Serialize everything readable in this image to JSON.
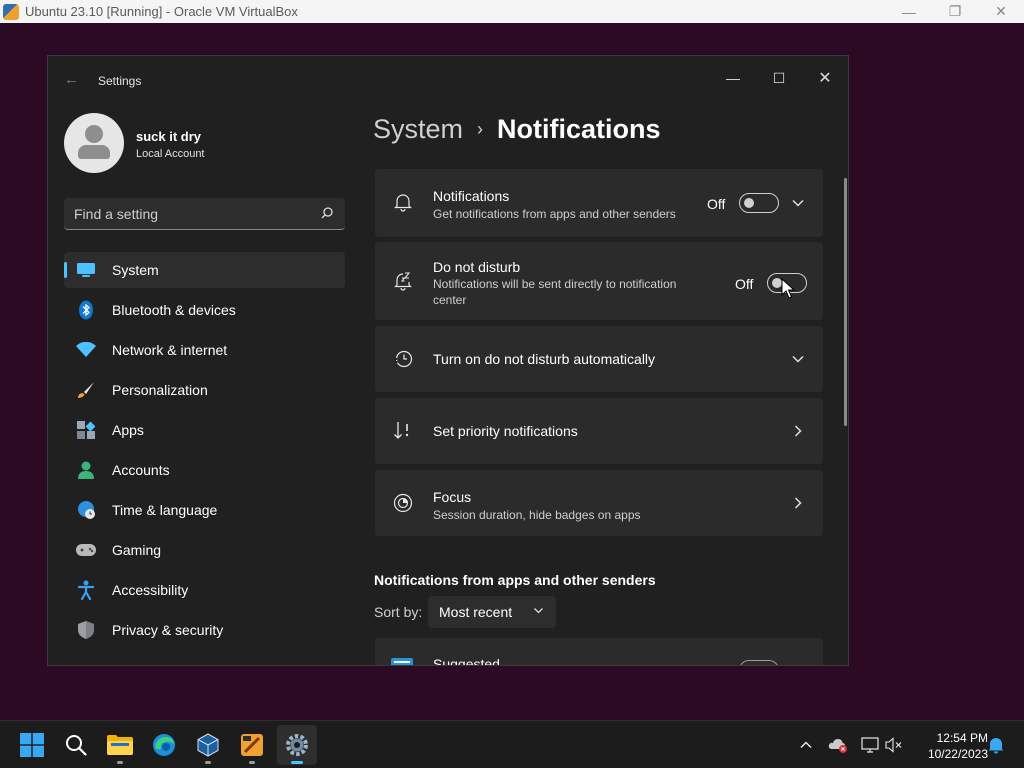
{
  "host": {
    "title": "Ubuntu 23.10 [Running] - Oracle VM VirtualBox",
    "controls": {
      "minimize": "—",
      "restore": "❐",
      "close": "✕"
    }
  },
  "window": {
    "title": "Settings",
    "back_glyph": "←",
    "controls": {
      "minimize": "—",
      "maximize": "☐",
      "close": "✕"
    }
  },
  "profile": {
    "name": "suck it dry",
    "account_type": "Local Account"
  },
  "search": {
    "placeholder": "Find a setting"
  },
  "nav": {
    "items": [
      {
        "label": "System",
        "icon": "system-icon",
        "active": true
      },
      {
        "label": "Bluetooth & devices",
        "icon": "bluetooth-icon"
      },
      {
        "label": "Network & internet",
        "icon": "wifi-icon"
      },
      {
        "label": "Personalization",
        "icon": "brush-icon"
      },
      {
        "label": "Apps",
        "icon": "apps-icon"
      },
      {
        "label": "Accounts",
        "icon": "person-icon"
      },
      {
        "label": "Time & language",
        "icon": "globe-clock-icon"
      },
      {
        "label": "Gaming",
        "icon": "gamepad-icon"
      },
      {
        "label": "Accessibility",
        "icon": "accessibility-icon"
      },
      {
        "label": "Privacy & security",
        "icon": "shield-icon"
      }
    ]
  },
  "breadcrumb": {
    "parent": "System",
    "separator": "›",
    "current": "Notifications"
  },
  "cards": {
    "notifications": {
      "title": "Notifications",
      "subtitle": "Get notifications from apps and other senders",
      "state": "Off",
      "toggle_on": false
    },
    "dnd": {
      "title": "Do not disturb",
      "subtitle": "Notifications will be sent directly to notification center",
      "state": "Off",
      "toggle_on": false
    },
    "auto_dnd": {
      "title": "Turn on do not disturb automatically"
    },
    "priority": {
      "title": "Set priority notifications"
    },
    "focus": {
      "title": "Focus",
      "subtitle": "Session duration, hide badges on apps"
    }
  },
  "senders": {
    "heading": "Notifications from apps and other senders",
    "sort_label": "Sort by:",
    "sort_value": "Most recent",
    "first_item": "Suggested"
  },
  "taskbar": {
    "apps": [
      "start-icon",
      "search-icon",
      "file-explorer-icon",
      "edge-icon",
      "virtualbox-icon",
      "app-icon",
      "settings-icon"
    ],
    "time": "12:54 PM",
    "date": "10/22/2023"
  },
  "colors": {
    "accent": "#4cc2ff",
    "window_bg": "#202020",
    "card_bg": "#2b2b2b",
    "desktop_bg": "#2d0a23"
  }
}
